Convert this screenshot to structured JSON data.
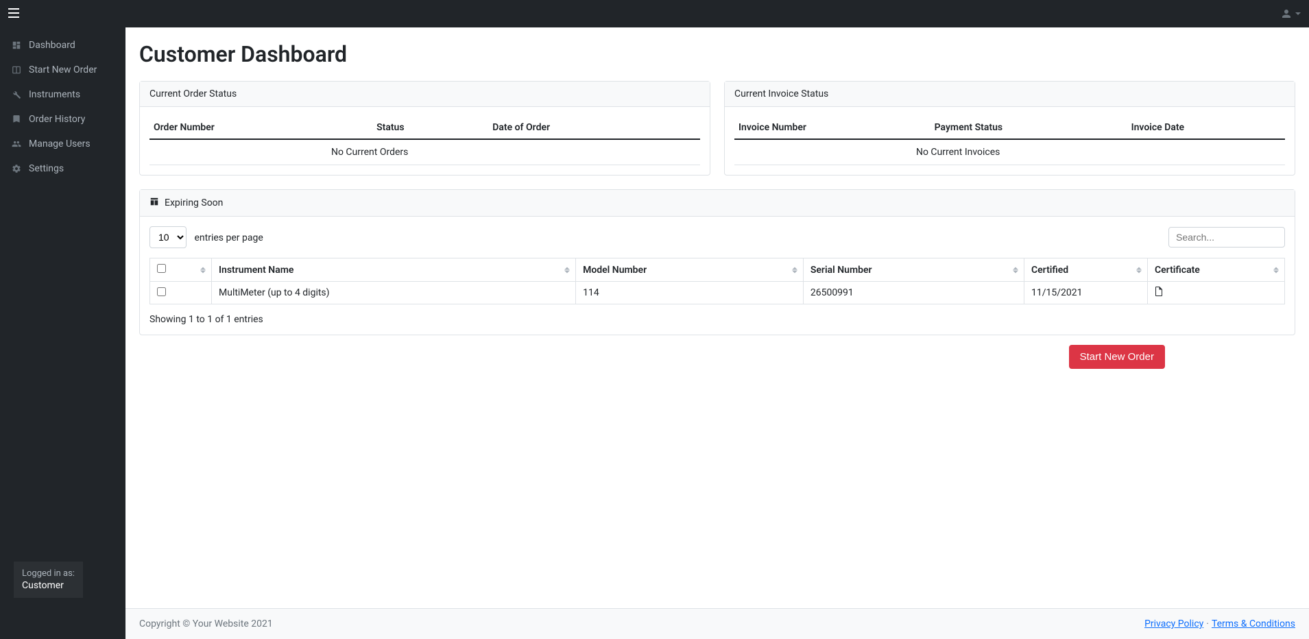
{
  "sidebar": {
    "items": [
      {
        "label": "Dashboard",
        "icon": "dashboard-icon"
      },
      {
        "label": "Start New Order",
        "icon": "columns-icon"
      },
      {
        "label": "Instruments",
        "icon": "wrench-icon"
      },
      {
        "label": "Order History",
        "icon": "book-icon"
      },
      {
        "label": "Manage Users",
        "icon": "users-icon"
      },
      {
        "label": "Settings",
        "icon": "gear-icon"
      }
    ],
    "login_prefix": "Logged in as:",
    "login_role": "Customer"
  },
  "page": {
    "title": "Customer Dashboard"
  },
  "orders_card": {
    "header": "Current Order Status",
    "columns": [
      "Order Number",
      "Status",
      "Date of Order"
    ],
    "empty": "No Current Orders"
  },
  "invoices_card": {
    "header": "Current Invoice Status",
    "columns": [
      "Invoice Number",
      "Payment Status",
      "Invoice Date"
    ],
    "empty": "No Current Invoices"
  },
  "expiring_card": {
    "header": "Expiring Soon",
    "entries_value": "10",
    "entries_label": "entries per page",
    "search_placeholder": "Search...",
    "columns": [
      "",
      "Instrument Name",
      "Model Number",
      "Serial Number",
      "Certified",
      "Certificate"
    ],
    "rows": [
      {
        "instrument_name": "MultiMeter (up to 4 digits)",
        "model_number": "114",
        "serial_number": "26500991",
        "certified": "11/15/2021",
        "certificate": "pdf"
      }
    ],
    "showing": "Showing 1 to 1 of 1 entries"
  },
  "actions": {
    "start_new_order": "Start New Order"
  },
  "footer": {
    "copyright": "Copyright © Your Website 2021",
    "privacy": "Privacy Policy",
    "separator": "·",
    "terms": "Terms & Conditions"
  }
}
